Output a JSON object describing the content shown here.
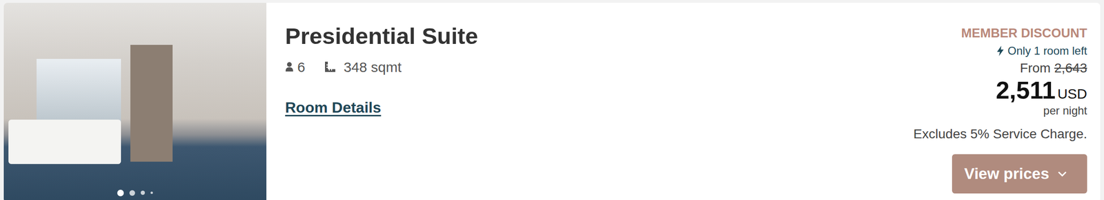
{
  "room": {
    "title": "Presidential Suite",
    "guests": "6",
    "size": "348 sqmt",
    "details_link": "Room Details"
  },
  "photo": {
    "dots": [
      {
        "selected": true
      },
      {
        "selected": false
      },
      {
        "selected": false
      },
      {
        "selected": false
      }
    ]
  },
  "pricing": {
    "badge": "MEMBER DISCOUNT",
    "availability": "Only 1 room left",
    "from_label": "From",
    "original_price": "2,643",
    "price": "2,511",
    "currency": "USD",
    "per": "per night",
    "note": "Excludes 5% Service Charge.",
    "button": "View prices"
  }
}
